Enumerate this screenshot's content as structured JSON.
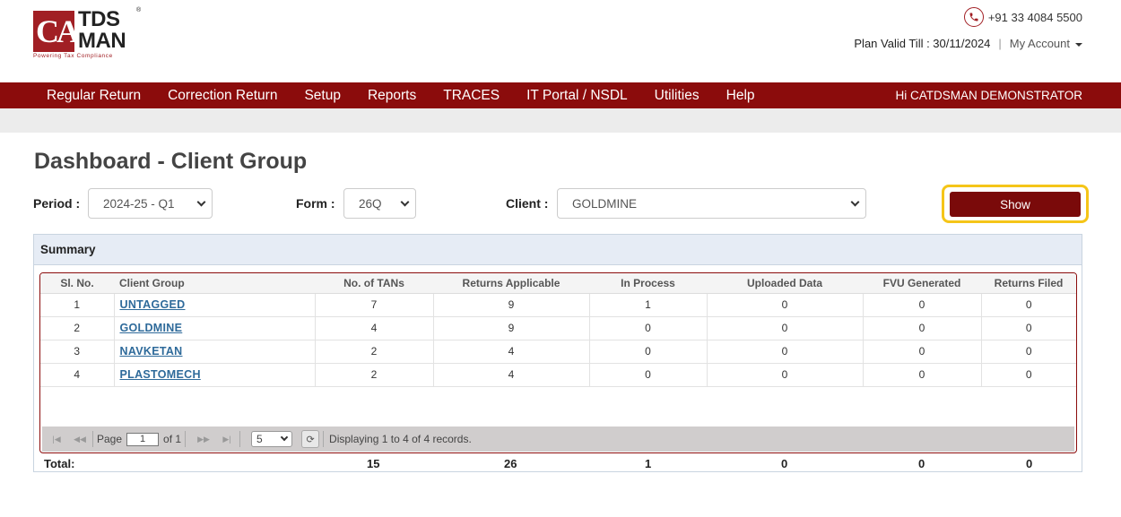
{
  "header": {
    "logo": {
      "mark": "CA",
      "line1": "TDS",
      "line2": "MAN",
      "reg": "®",
      "tagline": "Powering Tax Compliance"
    },
    "phone": "+91 33 4084 5500",
    "plan_valid": "Plan Valid Till : 30/11/2024",
    "separator": "|",
    "my_account": "My Account"
  },
  "nav": {
    "items": [
      "Regular Return",
      "Correction Return",
      "Setup",
      "Reports",
      "TRACES",
      "IT Portal / NSDL",
      "Utilities",
      "Help"
    ],
    "user": "Hi CATDSMAN DEMONSTRATOR"
  },
  "page_title": "Dashboard - Client Group",
  "filters": {
    "period_label": "Period :",
    "period_value": "2024-25 - Q1",
    "form_label": "Form :",
    "form_value": "26Q",
    "client_label": "Client :",
    "client_value": "GOLDMINE",
    "show_label": "Show"
  },
  "summary": {
    "title": "Summary",
    "columns": [
      "Sl. No.",
      "Client Group",
      "No. of TANs",
      "Returns Applicable",
      "In Process",
      "Uploaded Data",
      "FVU Generated",
      "Returns Filed"
    ],
    "rows": [
      [
        "1",
        "UNTAGGED",
        "7",
        "9",
        "1",
        "0",
        "0",
        "0"
      ],
      [
        "2",
        "GOLDMINE",
        "4",
        "9",
        "0",
        "0",
        "0",
        "0"
      ],
      [
        "3",
        "NAVKETAN",
        "2",
        "4",
        "0",
        "0",
        "0",
        "0"
      ],
      [
        "4",
        "PLASTOMECH",
        "2",
        "4",
        "0",
        "0",
        "0",
        "0"
      ]
    ],
    "pager": {
      "page_label": "Page",
      "page_value": "1",
      "of_label": "of 1",
      "page_size": "5",
      "display_text": "Displaying 1 to 4 of 4 records."
    },
    "totals": {
      "label": "Total:",
      "tans": "15",
      "applicable": "26",
      "in_process": "1",
      "uploaded": "0",
      "fvu": "0",
      "filed": "0"
    }
  }
}
